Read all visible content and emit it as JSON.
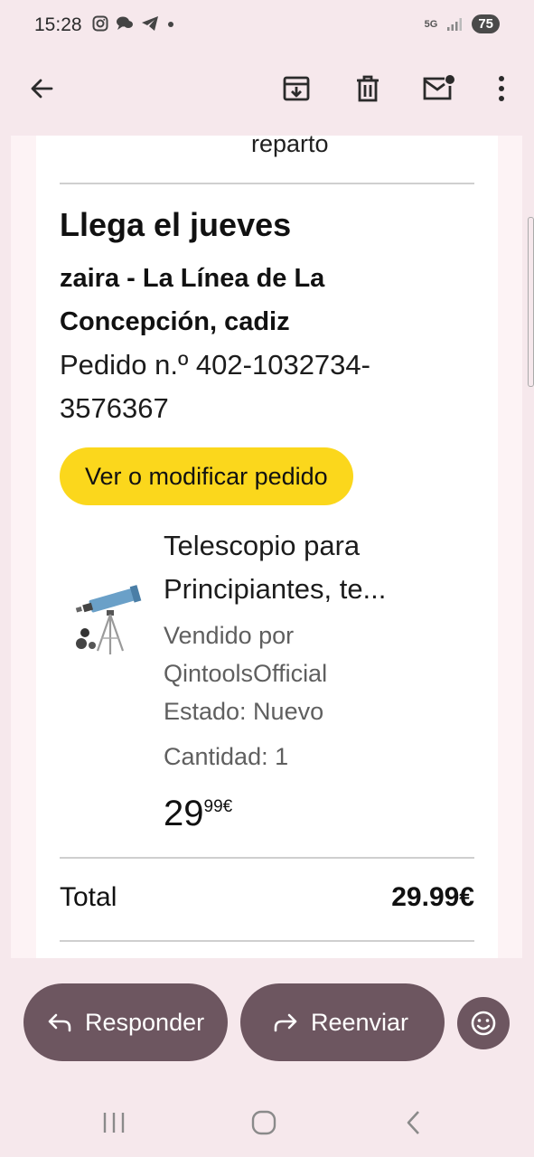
{
  "status_bar": {
    "time": "15:28",
    "network": "5G",
    "battery": "75",
    "notification_icons": [
      "instagram-icon",
      "chat-icon",
      "telegram-icon",
      "dot-icon"
    ]
  },
  "app_bar": {
    "icons": [
      "back-arrow-icon",
      "archive-icon",
      "delete-icon",
      "mark-unread-icon",
      "more-vert-icon"
    ]
  },
  "mail": {
    "prev_text": "reparto",
    "arrives": "Llega el jueves",
    "address": "zaira - La Línea de La Concepción, cadiz",
    "order_number": "Pedido n.º 402-1032734-3576367",
    "view_button": "Ver o modificar pedido",
    "product": {
      "title": "Telescopio para Principiantes, te...",
      "seller": "Vendido por QintoolsOfficial",
      "state": "Estado: Nuevo",
      "quantity": "Cantidad: 1",
      "price_main": "29",
      "price_sup": "99€"
    },
    "total_label": "Total",
    "total_value": "29.99€"
  },
  "actions": {
    "reply": "Responder",
    "forward": "Reenviar"
  },
  "colors": {
    "background": "#f6e8ec",
    "accent_button": "#fbd71c",
    "action_button": "#6d5660"
  }
}
